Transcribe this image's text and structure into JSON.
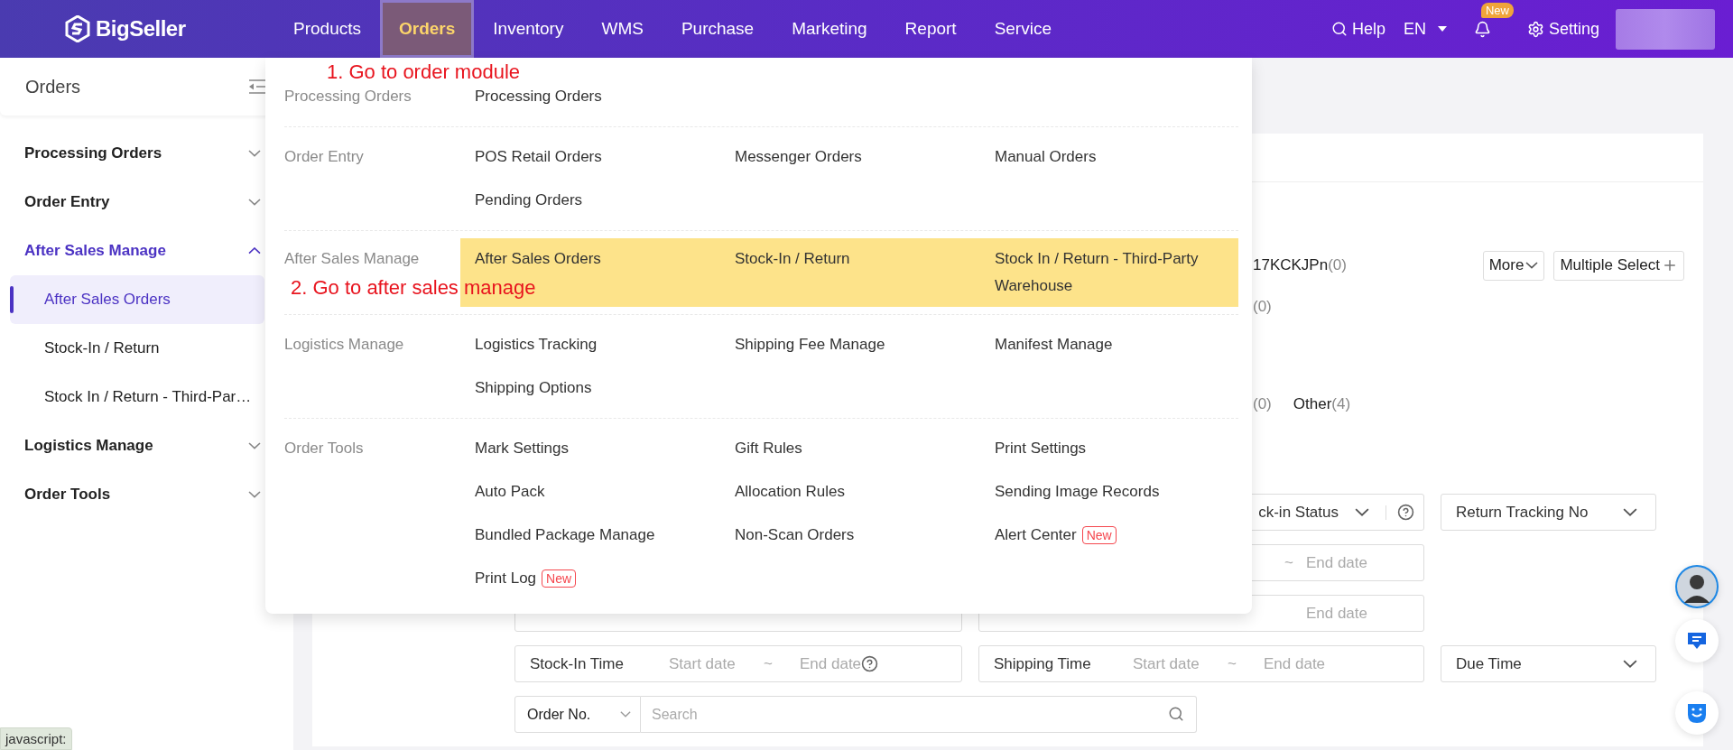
{
  "header": {
    "logo": "BigSeller",
    "nav": [
      {
        "label": "Products",
        "selected": false
      },
      {
        "label": "Orders",
        "selected": true
      },
      {
        "label": "Inventory",
        "selected": false
      },
      {
        "label": "WMS",
        "selected": false
      },
      {
        "label": "Purchase",
        "selected": false
      },
      {
        "label": "Marketing",
        "selected": false
      },
      {
        "label": "Report",
        "selected": false
      },
      {
        "label": "Service",
        "selected": false
      }
    ],
    "help": "Help",
    "language": "EN",
    "notification_badge": "New",
    "settings": "Setting"
  },
  "sidebar": {
    "title": "Orders",
    "groups": [
      {
        "label": "Processing Orders",
        "expanded": false,
        "selected": false
      },
      {
        "label": "Order Entry",
        "expanded": false,
        "selected": false
      },
      {
        "label": "After Sales Manage",
        "expanded": true,
        "selected": true,
        "children": [
          {
            "label": "After Sales Orders",
            "selected": true
          },
          {
            "label": "Stock-In / Return",
            "selected": false
          },
          {
            "label": "Stock In / Return - Third-Par…",
            "selected": false
          }
        ]
      },
      {
        "label": "Logistics Manage",
        "expanded": false,
        "selected": false
      },
      {
        "label": "Order Tools",
        "expanded": false,
        "selected": false
      }
    ]
  },
  "orders_menu": {
    "sections": [
      {
        "title": "Processing Orders",
        "highlighted": false,
        "items": [
          {
            "label": "Processing Orders"
          }
        ]
      },
      {
        "title": "Order Entry",
        "highlighted": false,
        "items": [
          {
            "label": "POS Retail Orders"
          },
          {
            "label": "Messenger Orders"
          },
          {
            "label": "Manual Orders"
          },
          {
            "label": "Pending Orders"
          }
        ]
      },
      {
        "title": "After Sales Manage",
        "highlighted": true,
        "items": [
          {
            "label": "After Sales Orders"
          },
          {
            "label": "Stock-In / Return"
          },
          {
            "label": "Stock In / Return - Third-Party Warehouse"
          }
        ]
      },
      {
        "title": "Logistics Manage",
        "highlighted": false,
        "items": [
          {
            "label": "Logistics Tracking"
          },
          {
            "label": "Shipping Fee Manage"
          },
          {
            "label": "Manifest Manage"
          },
          {
            "label": "Shipping Options"
          }
        ]
      },
      {
        "title": "Order Tools",
        "highlighted": false,
        "items": [
          {
            "label": "Mark Settings"
          },
          {
            "label": "Gift Rules"
          },
          {
            "label": "Print Settings"
          },
          {
            "label": "Auto Pack"
          },
          {
            "label": "Allocation Rules"
          },
          {
            "label": "Sending Image Records"
          },
          {
            "label": "Bundled Package Manage"
          },
          {
            "label": "Non-Scan Orders"
          },
          {
            "label": "Alert Center",
            "badge": "New"
          },
          {
            "label": "Print Log",
            "badge": "New"
          }
        ]
      }
    ]
  },
  "annotations": [
    {
      "text": "1. Go to order module"
    },
    {
      "text": "2. Go to after sales manage"
    }
  ],
  "content": {
    "tag_rows": [
      [
        {
          "label": "17KCKJPn",
          "count": "(0)"
        }
      ],
      [
        {
          "count": "(0)"
        }
      ],
      [
        {
          "count": "(0)"
        },
        {
          "label": "Other",
          "count": "(4)"
        }
      ]
    ],
    "more_button": "More",
    "multiple_select_button": "Multiple Select",
    "filter_rows": [
      [
        {
          "kind": "select",
          "partial": true,
          "label": "ck-in Status",
          "help": true
        },
        {
          "kind": "select",
          "partial": false,
          "label": "Return Tracking No",
          "help": false
        }
      ],
      [
        {
          "kind": "date_range",
          "partial": true,
          "separator": "~",
          "end": "End date",
          "help": false
        }
      ],
      [
        {
          "kind": "blank"
        },
        {
          "kind": "date_range",
          "partial": true,
          "end": "End date",
          "help": false
        }
      ],
      [
        {
          "kind": "date_range",
          "partial": false,
          "label": "Stock-In Time",
          "start": "Start date",
          "separator": "~",
          "end": "End date",
          "help": true
        },
        {
          "kind": "date_range",
          "partial": false,
          "label": "Shipping Time",
          "start": "Start date",
          "separator": "~",
          "end": "End date",
          "help": false
        },
        {
          "kind": "select",
          "partial": false,
          "label": "Due Time",
          "help": false
        }
      ],
      [
        {
          "kind": "search",
          "selector": "Order No.",
          "placeholder": "Search"
        }
      ]
    ]
  },
  "status_text": "javascript:"
}
